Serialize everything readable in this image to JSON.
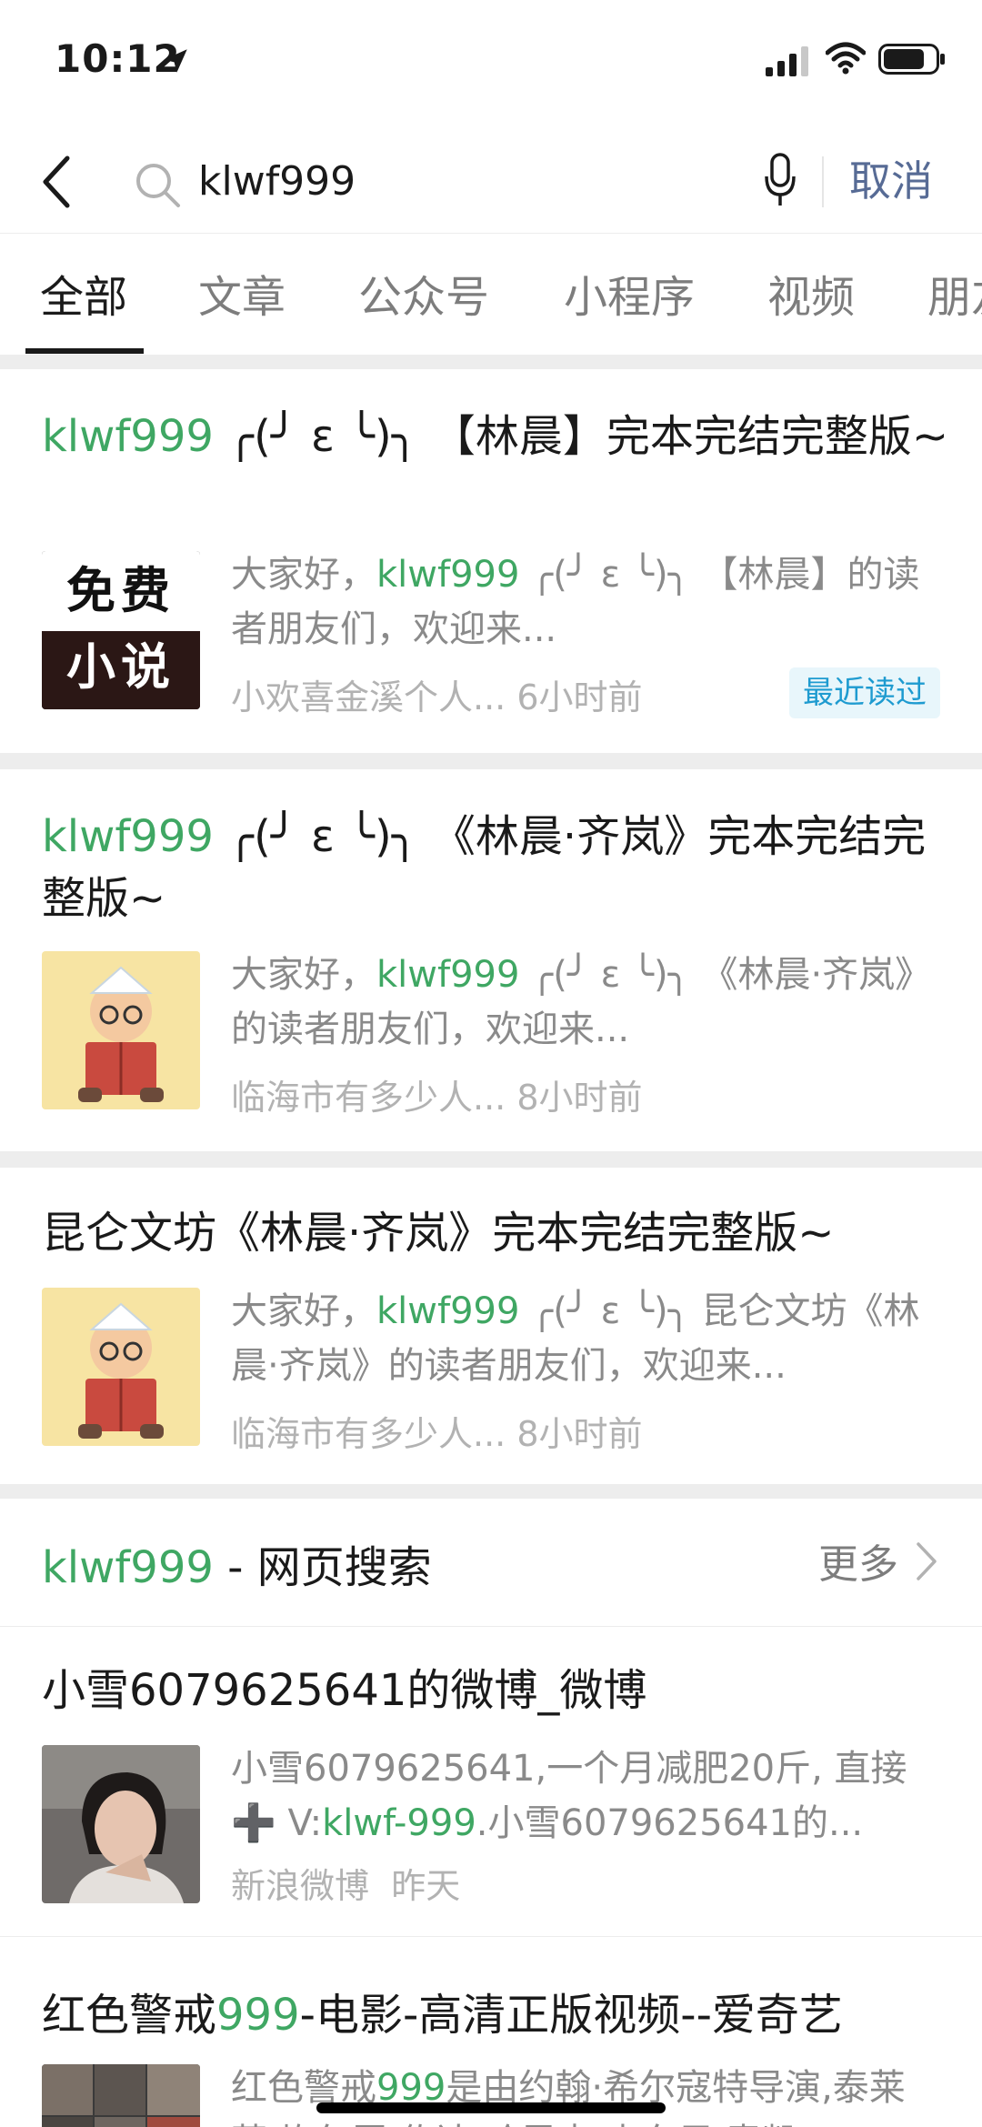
{
  "status": {
    "time": "10:12"
  },
  "search": {
    "query": "klwf999",
    "cancel_label": "取消"
  },
  "tabs": [
    "全部",
    "文章",
    "公众号",
    "小程序",
    "视频",
    "朋友圈"
  ],
  "results": [
    {
      "title_hl": "klwf999",
      "title_rest": " ╭(╯ ε ╰)╮ 【林晨】完本完结完整版~",
      "desc_pre": "大家好，",
      "desc_hl": "klwf999",
      "desc_rest": " ╭(╯ ε ╰)╮ 【林晨】的读者朋友们，欢迎来...",
      "source": "小欢喜金溪个人...",
      "time": "6小时前",
      "badge": "最近读过",
      "thumb_text_1": "免费",
      "thumb_text_2": "小说"
    },
    {
      "title_hl": "klwf999",
      "title_rest": " ╭(╯ ε ╰)╮ 《林晨·齐岚》完本完结完整版~",
      "desc_pre": "大家好，",
      "desc_hl": "klwf999",
      "desc_rest": " ╭(╯ ε ╰)╮ 《林晨·齐岚》的读者朋友们，欢迎来...",
      "source": "临海市有多少人...",
      "time": "8小时前"
    },
    {
      "title": "昆仑文坊《林晨·齐岚》完本完结完整版~",
      "desc_pre": "大家好，",
      "desc_hl": "klwf999",
      "desc_rest": " ╭(╯ ε ╰)╮ 昆仑文坊《林晨·齐岚》的读者朋友们，欢迎来...",
      "source": "临海市有多少人...",
      "time": "8小时前"
    }
  ],
  "web_section": {
    "title_hl": "klwf999",
    "title_rest": " - 网页搜索",
    "more_label": "更多"
  },
  "web_results": [
    {
      "title": "小雪6079625641的微博_微博",
      "desc_pre": "小雪6079625641,一个月减肥20斤, 直接➕ V:",
      "desc_hl": "klwf-999",
      "desc_rest": ".小雪6079625641的...",
      "source": "新浪微博",
      "time": "昨天"
    },
    {
      "title_pre": "红色警戒",
      "title_hl": "999",
      "title_rest": "-电影-高清正版视频--爱奇艺",
      "desc_pre": "红色警戒",
      "desc_hl": "999",
      "desc_rest": "是由约翰·希尔寇特导演,泰莱莱·坎尔罗·佐达·哈里森·史东尼·青凯..."
    }
  ],
  "colors": {
    "highlight": "#3fa763",
    "link": "#576b95",
    "badge_bg": "#e8f6fb",
    "badge_text": "#1e9bd0"
  }
}
